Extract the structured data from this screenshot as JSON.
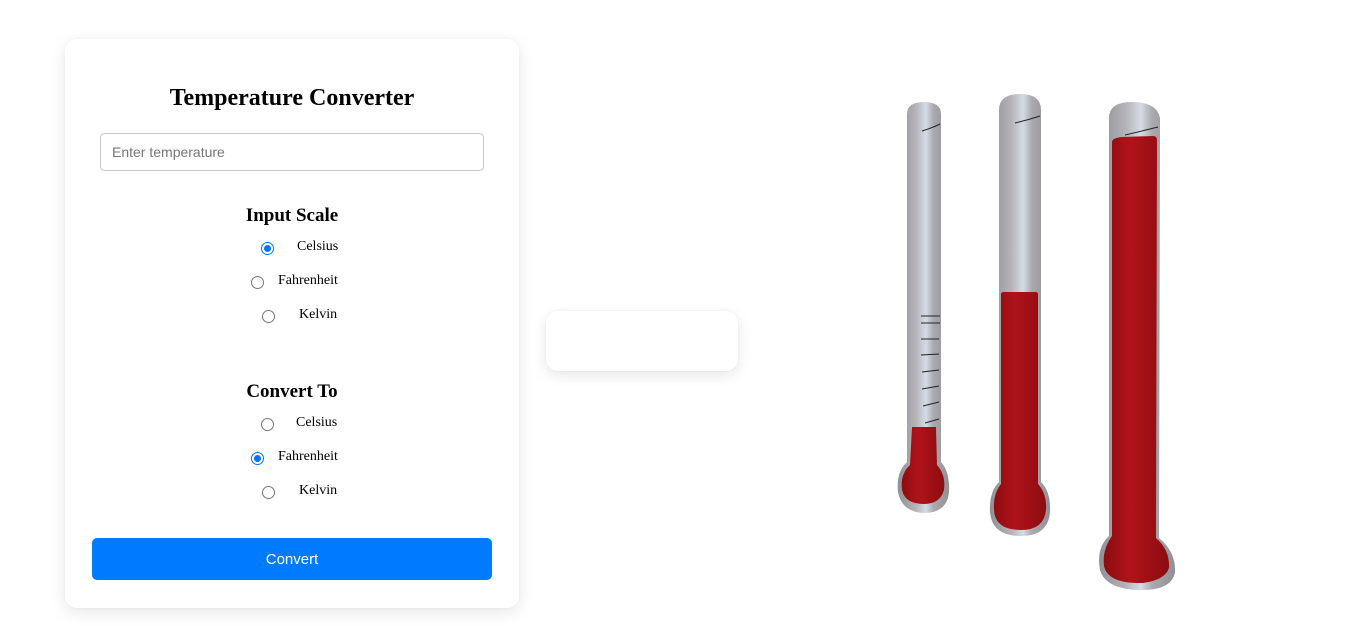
{
  "converter": {
    "title": "Temperature Converter",
    "input": {
      "value": "",
      "placeholder": "Enter temperature"
    },
    "input_scale": {
      "heading": "Input Scale",
      "options": [
        {
          "label": "Celsius",
          "checked": true
        },
        {
          "label": "Fahrenheit",
          "checked": false
        },
        {
          "label": "Kelvin",
          "checked": false
        }
      ]
    },
    "convert_to": {
      "heading": "Convert To",
      "options": [
        {
          "label": "Celsius",
          "checked": false
        },
        {
          "label": "Fahrenheit",
          "checked": true
        },
        {
          "label": "Kelvin",
          "checked": false
        }
      ]
    },
    "convert_button_label": "Convert"
  },
  "result": {
    "text": ""
  },
  "thermometers": [
    {
      "name": "thermometer-1",
      "fill_level": 0.15
    },
    {
      "name": "thermometer-2",
      "fill_level": 0.52
    },
    {
      "name": "thermometer-3",
      "fill_level": 0.95
    }
  ],
  "colors": {
    "accent": "#007bff",
    "radio_checked": "#0075ff",
    "mercury": "#a30f14",
    "glass": "#a8a8ad"
  }
}
